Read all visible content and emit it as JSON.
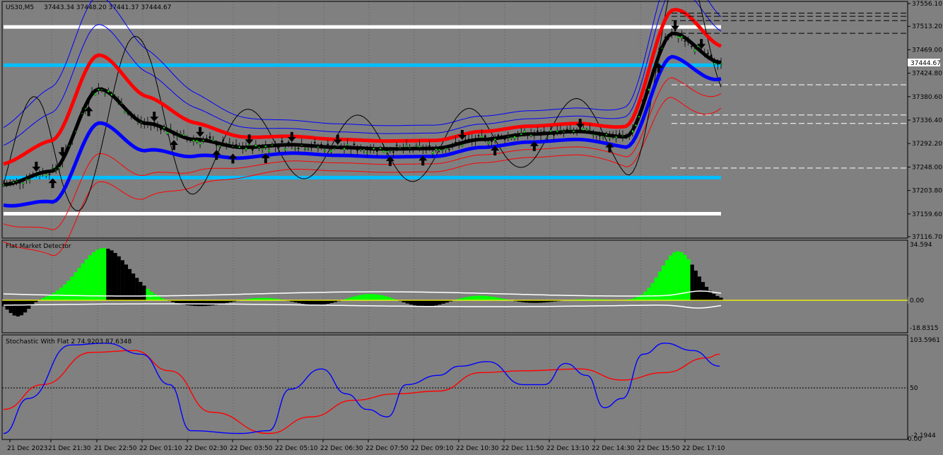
{
  "chart_header": {
    "symbol": "US30,M5",
    "ohlc": "37443.34 37448.20 37441.37 37444.67"
  },
  "price_pane": {
    "y_ticks": [
      "37556.10",
      "37513.20",
      "37469.00",
      "37424.80",
      "37380.60",
      "37336.40",
      "37292.20",
      "37248.00",
      "37203.80",
      "37159.60",
      "37116.70"
    ],
    "current_price": "37444.67",
    "ylim": [
      37116.7,
      37556.1
    ]
  },
  "fmd_pane": {
    "title": "Flat Market Detector",
    "y_ticks": [
      "34.594",
      "0.00",
      "-18.8315"
    ]
  },
  "stoch_pane": {
    "title": "Stochastic With Flat 2 74.9203 87.6348",
    "y_ticks": [
      "103.5961",
      "50",
      "-2.1944"
    ],
    "extra_tick": "0.00"
  },
  "time_axis": [
    "21 Dec 2023",
    "21 Dec 21:30",
    "21 Dec 22:50",
    "22 Dec 01:10",
    "22 Dec 02:30",
    "22 Dec 03:50",
    "22 Dec 05:10",
    "22 Dec 06:30",
    "22 Dec 07:50",
    "22 Dec 09:10",
    "22 Dec 10:30",
    "22 Dec 11:50",
    "22 Dec 13:10",
    "22 Dec 14:30",
    "22 Dec 15:50",
    "22 Dec 17:10"
  ],
  "colors": {
    "background": "#808080",
    "grid": "#000000",
    "white_levels": "#ffffff",
    "cyan_levels": "#00bfff",
    "band_red": "#ff0000",
    "band_blue": "#0000ff",
    "histogram_green": "#00ff00",
    "histogram_black": "#000000",
    "zero_line": "#ffff00",
    "stoch_main": "#0000ff",
    "stoch_signal": "#ff0000"
  },
  "chart_data": {
    "type": "line",
    "title": "US30,M5",
    "xlabel": "",
    "ylabel": "",
    "ylim": [
      37116.7,
      37556.1
    ],
    "x": [
      "21 Dec 2023",
      "21 Dec 21:30",
      "21 Dec 22:50",
      "22 Dec 01:10",
      "22 Dec 02:30",
      "22 Dec 03:50",
      "22 Dec 05:10",
      "22 Dec 06:30",
      "22 Dec 07:50",
      "22 Dec 09:10",
      "22 Dec 10:30",
      "22 Dec 11:50",
      "22 Dec 13:10",
      "22 Dec 14:30",
      "22 Dec 15:50",
      "22 Dec 17:10"
    ],
    "series": [
      {
        "values": [
          37215,
          37240,
          37395,
          37330,
          37300,
          37285,
          37290,
          37285,
          37282,
          37283,
          37300,
          37310,
          37315,
          37305,
          37500,
          37445
        ]
      }
    ],
    "horizontal_levels": [
      37512,
      37440,
      37228,
      37160
    ]
  }
}
